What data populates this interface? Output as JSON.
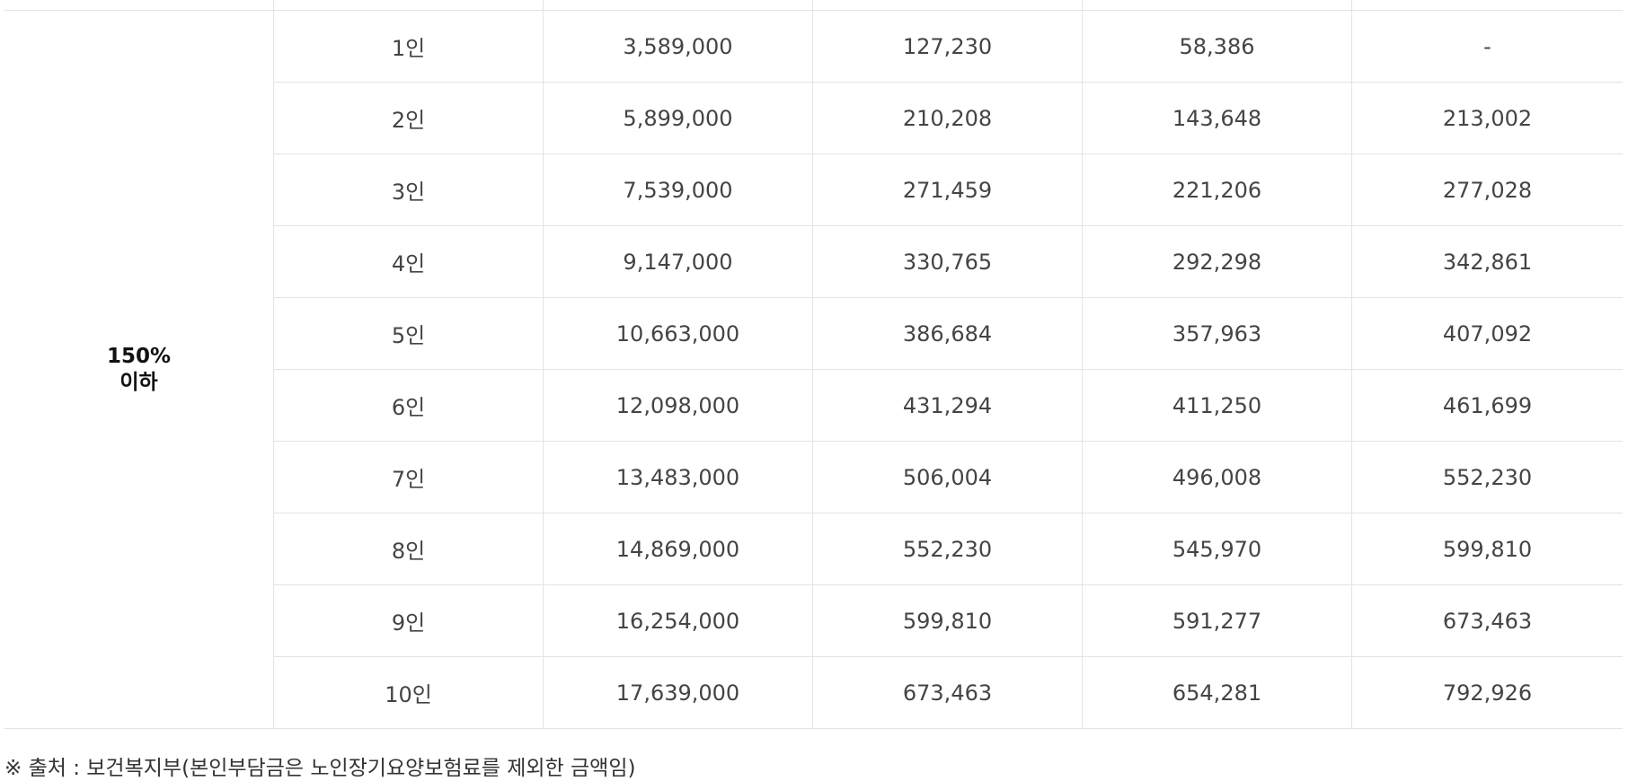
{
  "table": {
    "group_label": "150%\n이하",
    "rows": [
      [
        "1인",
        "3,589,000",
        "127,230",
        "58,386",
        "-"
      ],
      [
        "2인",
        "5,899,000",
        "210,208",
        "143,648",
        "213,002"
      ],
      [
        "3인",
        "7,539,000",
        "271,459",
        "221,206",
        "277,028"
      ],
      [
        "4인",
        "9,147,000",
        "330,765",
        "292,298",
        "342,861"
      ],
      [
        "5인",
        "10,663,000",
        "386,684",
        "357,963",
        "407,092"
      ],
      [
        "6인",
        "12,098,000",
        "431,294",
        "411,250",
        "461,699"
      ],
      [
        "7인",
        "13,483,000",
        "506,004",
        "496,008",
        "552,230"
      ],
      [
        "8인",
        "14,869,000",
        "552,230",
        "545,970",
        "599,810"
      ],
      [
        "9인",
        "16,254,000",
        "599,810",
        "591,277",
        "673,463"
      ],
      [
        "10인",
        "17,639,000",
        "673,463",
        "654,281",
        "792,926"
      ]
    ]
  },
  "footnote": "※ 출처 : 보건복지부(본인부담금은 노인장기요양보험료를 제외한 금액임)"
}
